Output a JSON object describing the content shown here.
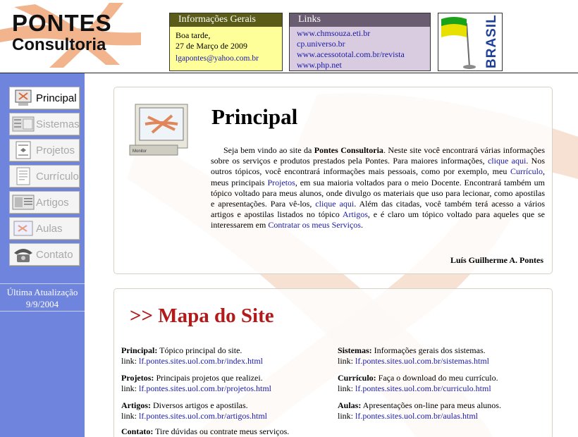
{
  "header": {
    "logo_line1": "PONTES",
    "logo_line2": "Consultoria",
    "info": {
      "title": "Informações Gerais",
      "greeting": "Boa tarde,",
      "date": "27 de Março de 2009",
      "email": "lgapontes@yahoo.com.br"
    },
    "links": {
      "title": "Links",
      "items": [
        "www.chmsouza.eti.br",
        "cp.universo.br",
        "www.acessototal.com.br/revista",
        "www.php.net"
      ]
    },
    "flag_text": "BRASIL"
  },
  "nav": {
    "items": [
      {
        "label": "Principal",
        "icon": "monitor-icon",
        "active": true
      },
      {
        "label": "Sistemas",
        "icon": "systems-icon",
        "active": false
      },
      {
        "label": "Projetos",
        "icon": "projects-icon",
        "active": false
      },
      {
        "label": "Currículo",
        "icon": "resume-icon",
        "active": false
      },
      {
        "label": "Artigos",
        "icon": "articles-icon",
        "active": false
      },
      {
        "label": "Aulas",
        "icon": "classes-icon",
        "active": false
      },
      {
        "label": "Contato",
        "icon": "phone-icon",
        "active": false
      }
    ]
  },
  "update": {
    "label": "Última Atualização",
    "date": "9/9/2004"
  },
  "main": {
    "title": "Principal",
    "monitor_label": "Monitor",
    "p1": "Seja bem vindo ao site da ",
    "company": "Pontes Consultoria",
    "p2": ". Neste site você encontrará várias informações sobre os serviços e produtos prestados pela Pontes. Para maiores informações, ",
    "link_here1": "clique aqui",
    "p3": ". Nos outros tópicos, você encontrará informações mais pessoais, como por exemplo, meu ",
    "link_curriculo": "Currículo",
    "p4": ", meus principais ",
    "link_projetos": "Projetos",
    "p5": ", em sua maioria voltados para o meio Docente. Encontrará também um tópico voltado para meus alunos, onde divulgo os materiais que uso para lecionar, como apostilas e apresentações. Para vê-los, ",
    "link_here2": "clique aqui",
    "p6": ". Além das citadas, você também terá acesso a vários artigos e apostilas listados no tópico ",
    "link_artigos": "Artigos",
    "p7": ", e é claro um tópico voltado para aqueles que se interessarem em ",
    "link_servicos": "Contratar os meus Serviços",
    "p8": ".",
    "signature": "Luís Guilherme A. Pontes"
  },
  "sitemap": {
    "title": ">> Mapa do Site",
    "link_prefix": "link: ",
    "items": [
      {
        "name": "Principal:",
        "desc": " Tópico principal do site.",
        "url": "lf.pontes.sites.uol.com.br/index.html"
      },
      {
        "name": "Sistemas:",
        "desc": " Informações gerais dos sistemas.",
        "url": "lf.pontes.sites.uol.com.br/sistemas.html"
      },
      {
        "name": "Projetos:",
        "desc": " Principais projetos que realizei.",
        "url": "lf.pontes.sites.uol.com.br/projetos.html"
      },
      {
        "name": "Currículo:",
        "desc": " Faça o download do meu currículo.",
        "url": "lf.pontes.sites.uol.com.br/curriculo.html"
      },
      {
        "name": "Artigos:",
        "desc": " Diversos artigos e apostilas.",
        "url": "lf.pontes.sites.uol.com.br/artigos.html"
      },
      {
        "name": "Aulas:",
        "desc": " Apresentações on-line para meus alunos.",
        "url": "lf.pontes.sites.uol.com.br/aulas.html"
      },
      {
        "name": "Contato:",
        "desc": " Tire dúvidas ou contrate meus serviços.",
        "url": ""
      }
    ]
  },
  "colors": {
    "sidebar": "#6f84dd",
    "brand_orange": "#f2b48c",
    "map_title": "#b31b1b",
    "link": "#1a1aa6"
  }
}
